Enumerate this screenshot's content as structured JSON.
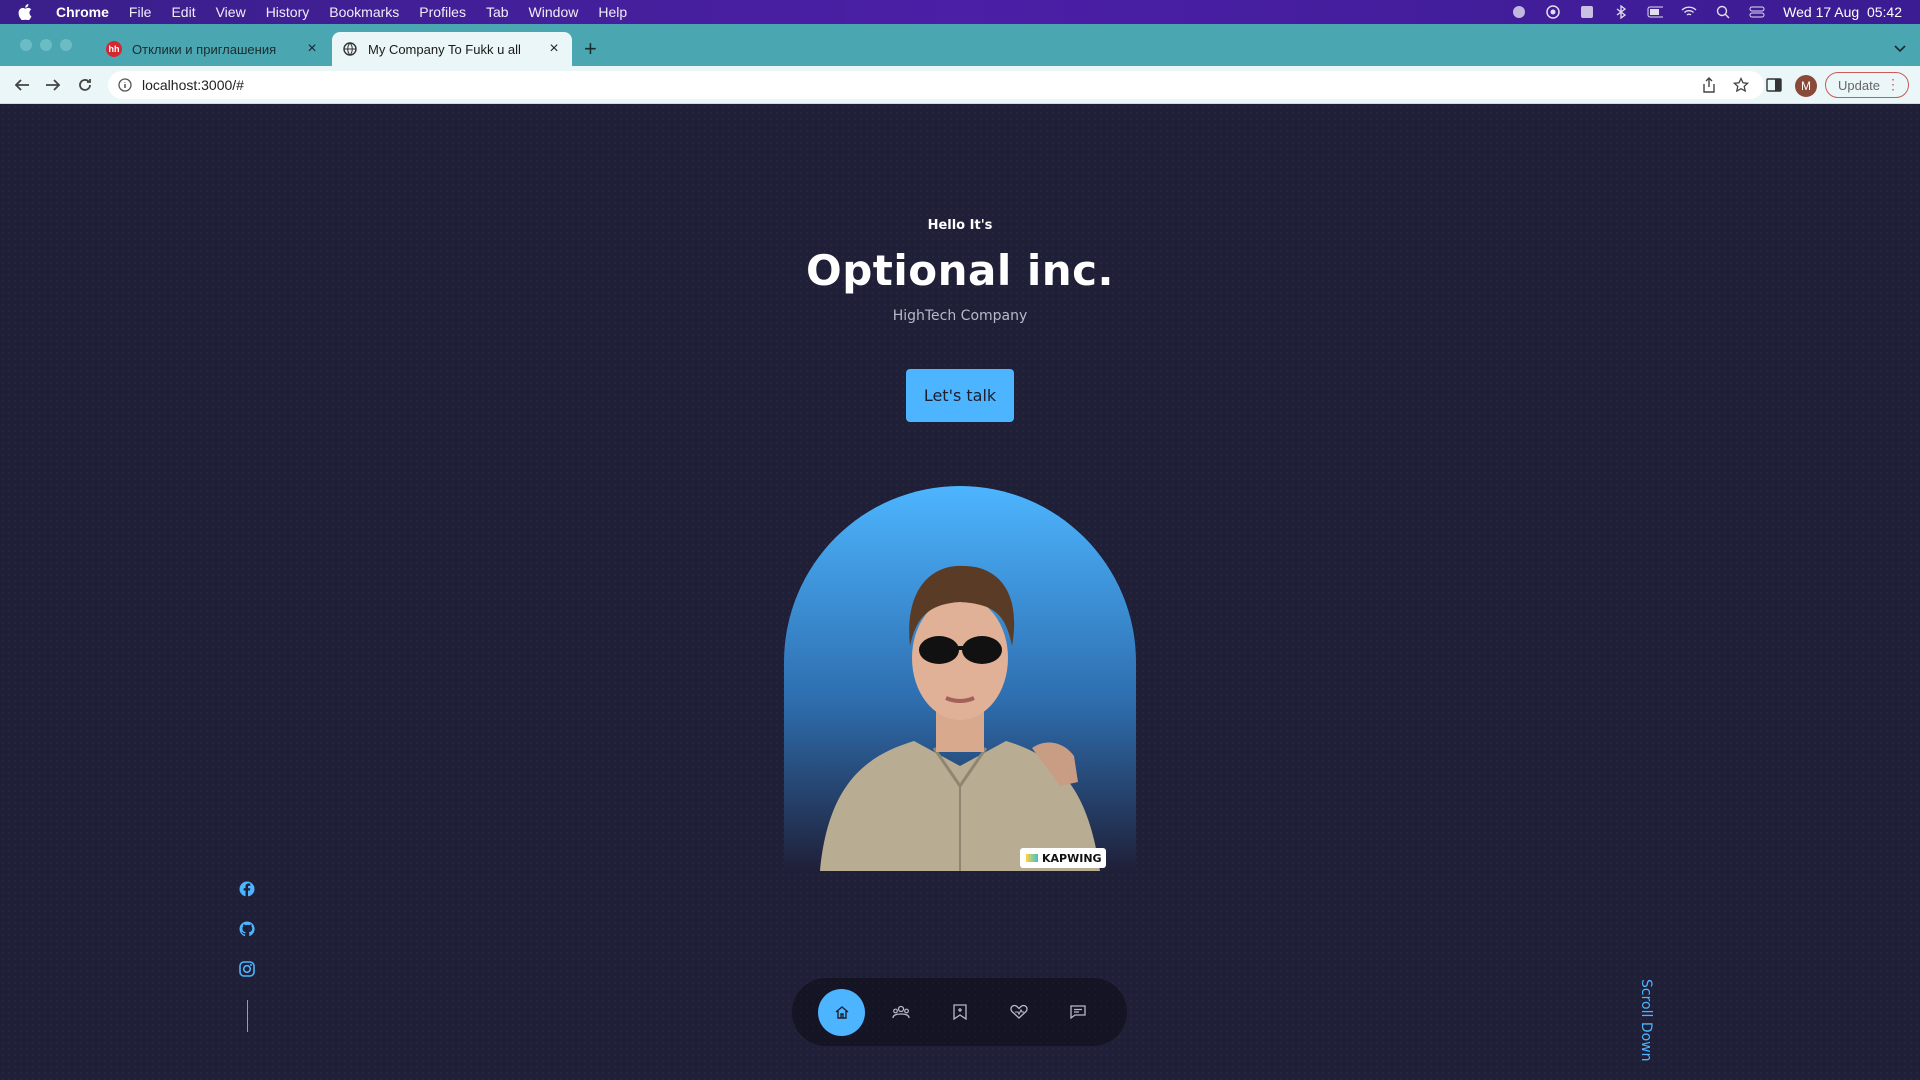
{
  "menubar": {
    "app": "Chrome",
    "items": [
      "File",
      "Edit",
      "View",
      "History",
      "Bookmarks",
      "Profiles",
      "Tab",
      "Window",
      "Help"
    ],
    "datetime": "Wed 17 Aug  05:42"
  },
  "tabs": [
    {
      "title": "Отклики и приглашения",
      "close": "×"
    },
    {
      "title": "My Company To Fukk u all",
      "close": "×"
    }
  ],
  "newtab": "+",
  "toolbar": {
    "url": "localhost:3000/#",
    "avatar_letter": "M",
    "update_label": "Update"
  },
  "hero": {
    "greeting": "Hello It's",
    "title": "Optional inc.",
    "subtitle": "HighTech Company",
    "cta": "Let's talk",
    "watermark": "KAPWING"
  },
  "scroll_label": "Scroll Down",
  "colors": {
    "accent": "#4db5ff",
    "background": "#1f1f38",
    "menubar": "#4b1fa6",
    "tabstrip": "#4aa7b1"
  },
  "icons": {
    "socials": [
      "facebook-icon",
      "github-icon",
      "instagram-icon"
    ],
    "dock": [
      "home-icon",
      "about-icon",
      "experience-icon",
      "services-icon",
      "contact-icon"
    ]
  }
}
